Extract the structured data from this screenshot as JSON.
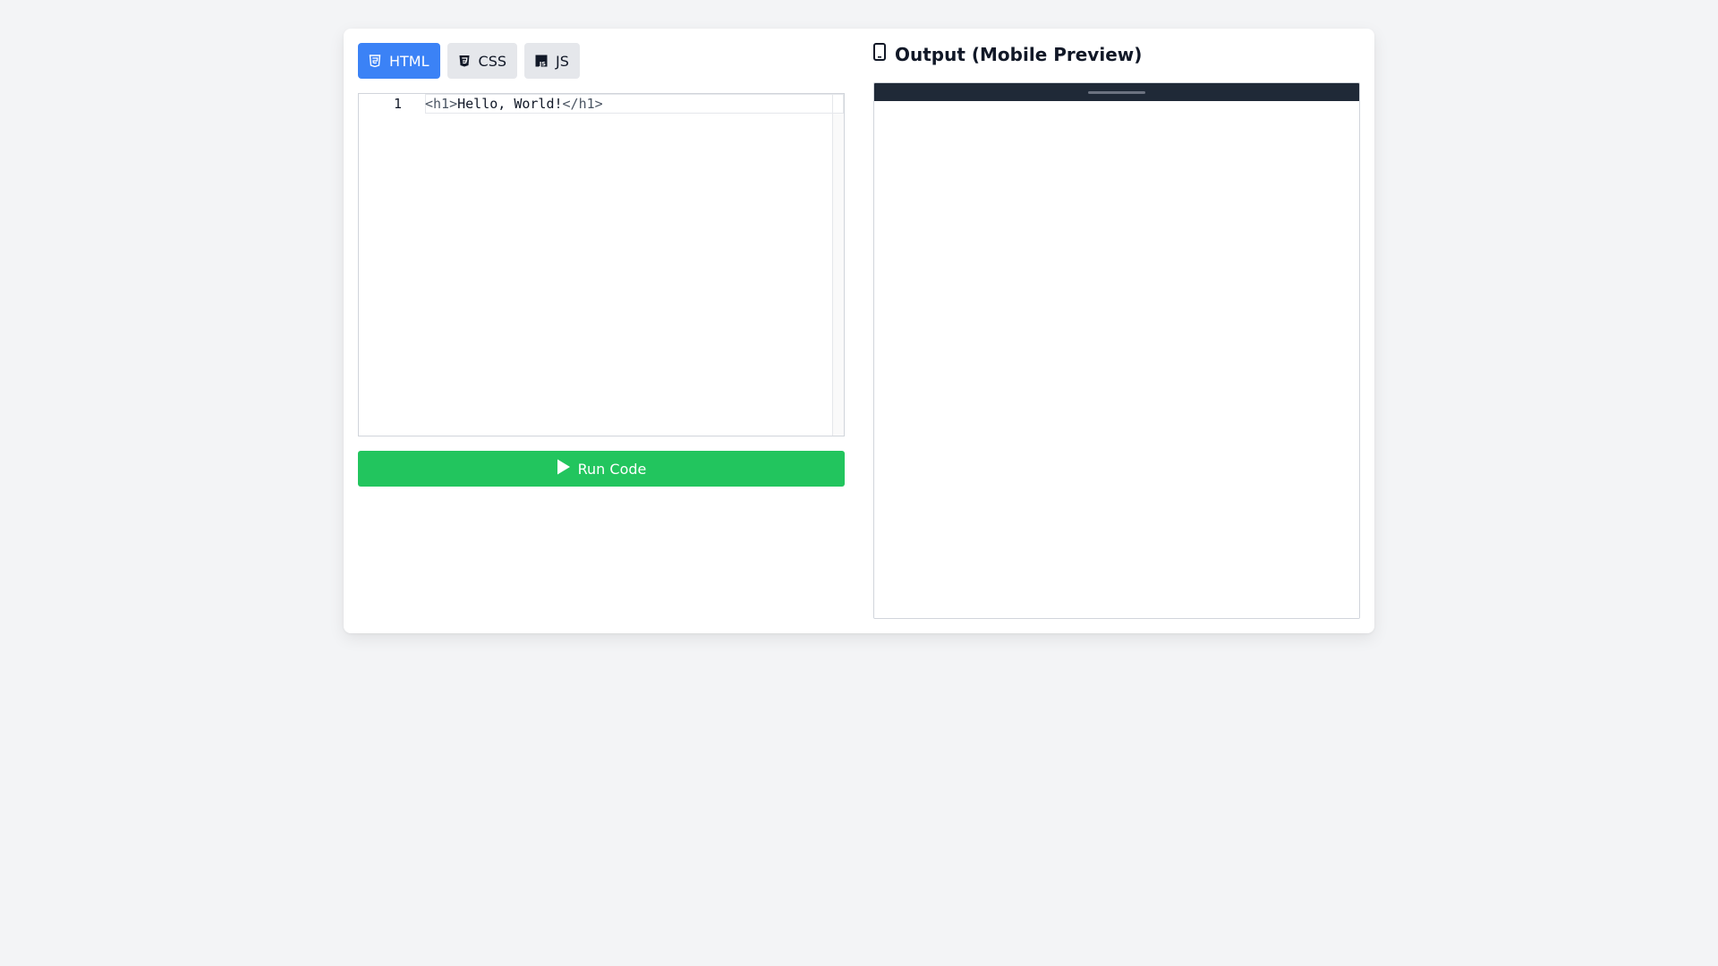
{
  "editor": {
    "tabs": [
      {
        "label": "HTML",
        "icon": "html5-icon",
        "active": true
      },
      {
        "label": "CSS",
        "icon": "css3-icon",
        "active": false
      },
      {
        "label": "JS",
        "icon": "js-icon",
        "active": false
      }
    ],
    "lines": [
      {
        "number": "1",
        "open_tag": "<h1>",
        "text": "Hello, World!",
        "close_tag": "</h1>"
      }
    ],
    "run_label": "Run Code"
  },
  "output": {
    "title": "Output (Mobile Preview)",
    "icon": "mobile-phone-icon"
  },
  "colors": {
    "active_tab": "#3b82f6",
    "run_button": "#22c55e",
    "preview_bar": "#1f2937",
    "page_bg": "#f3f4f6"
  }
}
